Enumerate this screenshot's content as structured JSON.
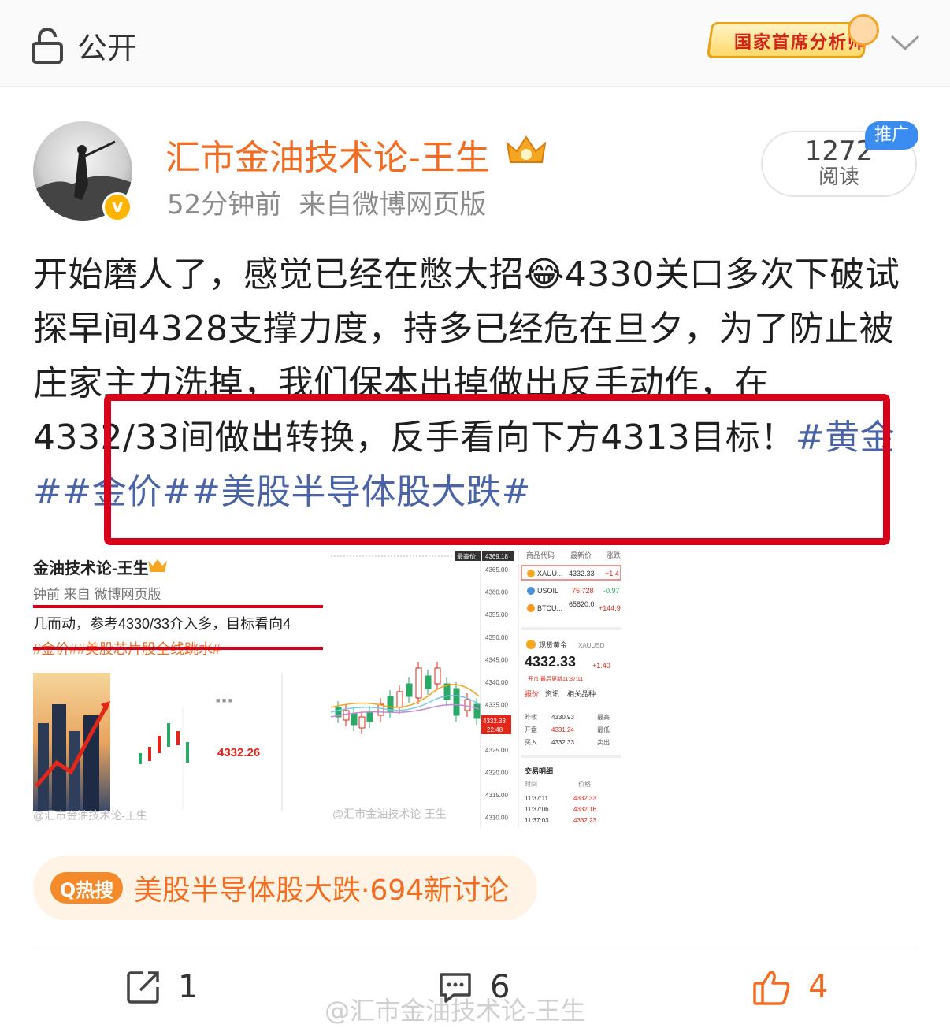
{
  "topbar": {
    "privacy_label": "公开",
    "title_badge": "国家首席分析师"
  },
  "post": {
    "author": "汇市金油技术论-王生",
    "time": "52分钟前",
    "source": "来自微博网页版",
    "reads_count": "1272",
    "reads_label": "阅读",
    "promo_label": "推广",
    "text_part1": "开始磨人了，感觉已经在憋大招",
    "emoji": "😂",
    "text_part2": "4330关口多次下破试探早间4328支撑力度，持多已经危在旦夕，为了防止被庄家主力洗掉，我们保本出掉做出反手动作，在4332/33间做出转换，反手看向下方4313目标！",
    "tags": [
      "#黄金#",
      "#金价#",
      "#美股半导体股大跌#"
    ]
  },
  "image_left": {
    "author": "金油技术论-王生",
    "meta": "钟前  来自 微博网页版",
    "text": "几而动，参考4330/33介入多，目标看向4",
    "tags_struck": "#金价##美股芯片股全线跳水#",
    "mini_price": "4332.26",
    "watermark": "@汇市金油技术论-王生"
  },
  "image_right": {
    "top_labels": [
      "最高价",
      "4369.18"
    ],
    "y_ticks": [
      "4365.00",
      "4360.00",
      "4355.00",
      "4350.00",
      "4345.00",
      "4340.00",
      "4335.00",
      "4332.33",
      "4325.00",
      "4320.00",
      "4315.00",
      "4310.00"
    ],
    "current_time": "22:48",
    "quote_header": [
      "商品代码",
      "最新价",
      "涨跌"
    ],
    "quotes": [
      {
        "code": "XAUU...",
        "price": "4332.33",
        "chg": "+1.4"
      },
      {
        "code": "USOIL",
        "price": "75.728",
        "chg": "-0.97"
      },
      {
        "code": "BTCU...",
        "price": "65820.0",
        "chg": "+144.9"
      }
    ],
    "gold_name": "现货黄金",
    "gold_symbol": "XAUUSD",
    "gold_price": "4332.33",
    "gold_change": "+1.40",
    "gold_status": "开市 最后更新11:37:11",
    "tabs": [
      "报价",
      "资讯",
      "相关品种"
    ],
    "stats": [
      {
        "k": "昨收",
        "v": "4330.93",
        "k2": "最高"
      },
      {
        "k": "开盘",
        "v": "4331.24",
        "k2": "最低"
      },
      {
        "k": "买入",
        "v": "4332.33",
        "k2": "卖出"
      }
    ],
    "trades_title": "交易明细",
    "trades_header": [
      "时间",
      "价格"
    ],
    "trades": [
      {
        "t": "11:37:11",
        "p": "4332.33"
      },
      {
        "t": "11:37:06",
        "p": "4332.16"
      },
      {
        "t": "11:37:03",
        "p": "4332.23"
      }
    ],
    "watermark": "@汇市金油技术论-王生"
  },
  "hot_search": {
    "pill": "Q热搜",
    "text": "美股半导体股大跌·694新讨论"
  },
  "actions": {
    "repost_count": "1",
    "comment_count": "6",
    "like_count": "4"
  },
  "watermark": "@汇市金油技术论-王生",
  "colors": {
    "author_orange": "#f26d22",
    "tag_blue": "#4a64a7",
    "highlight_red": "#d9001b",
    "like_orange": "#f26d22"
  }
}
